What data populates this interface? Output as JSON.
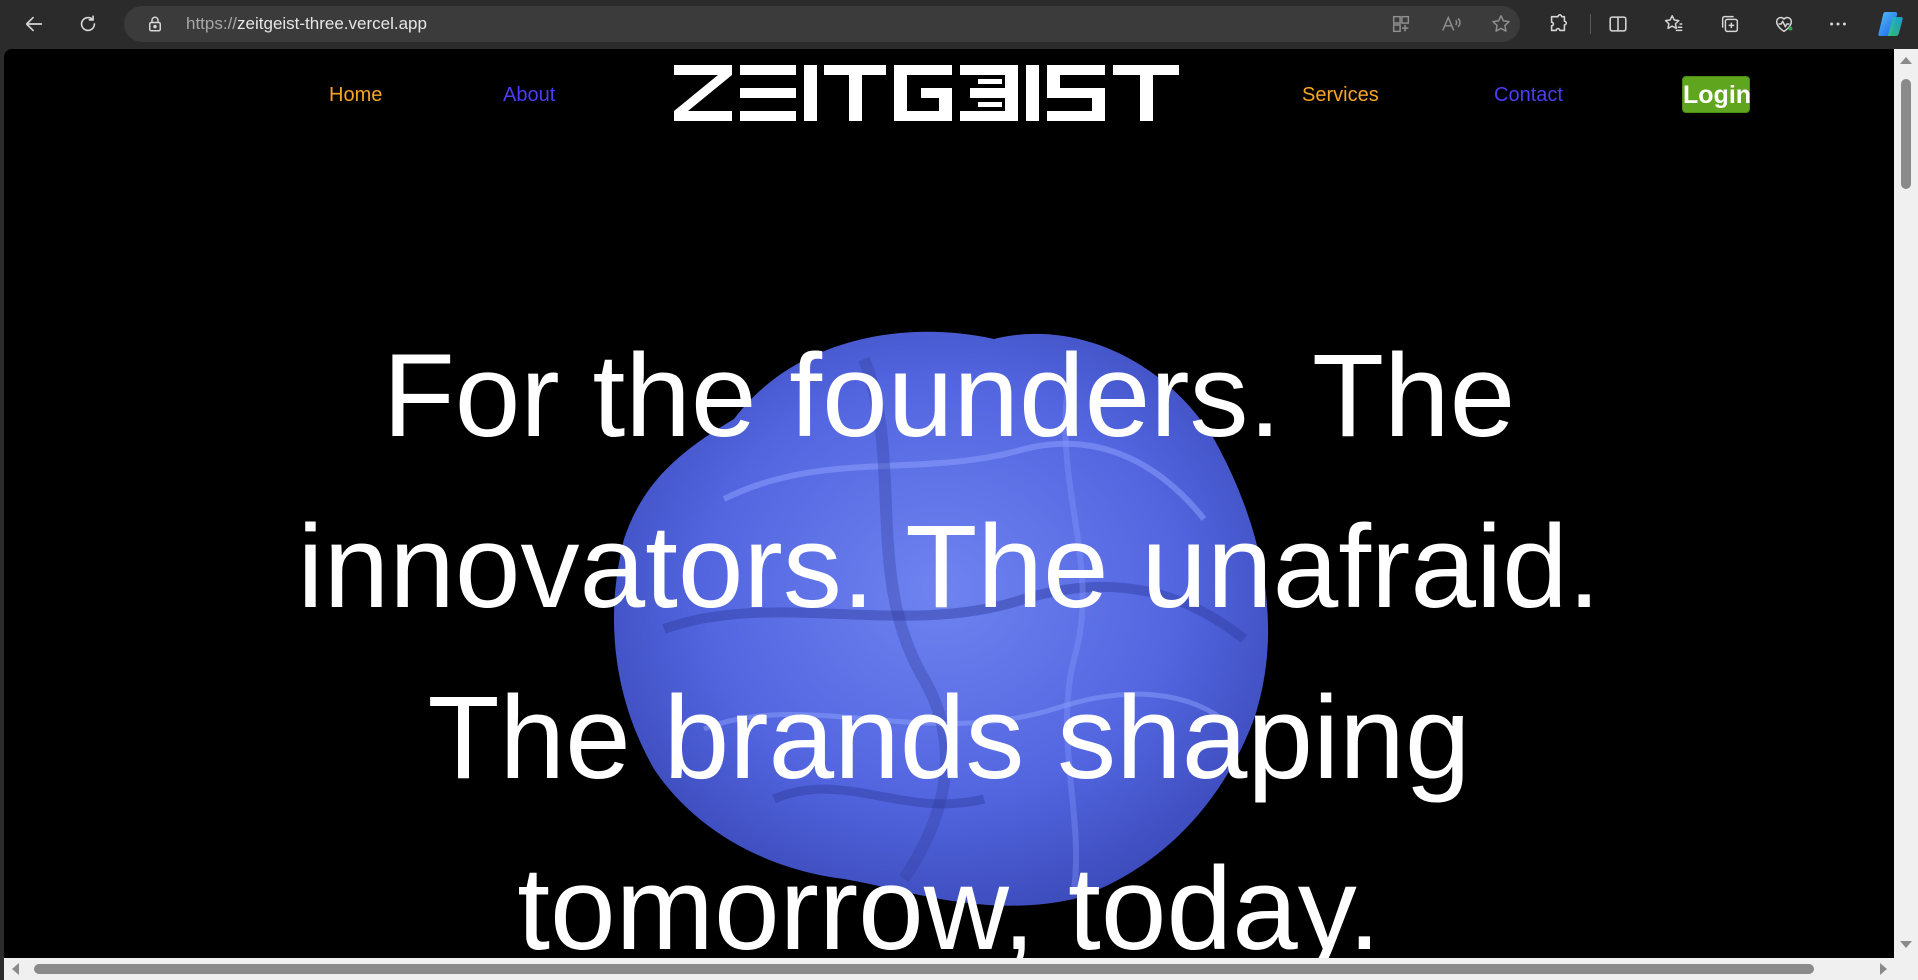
{
  "browser": {
    "url_protocol": "https://",
    "url_host": "zeitgeist-three.vercel.app",
    "icons": [
      "back-icon",
      "refresh-icon",
      "lock-icon",
      "app-available-icon",
      "read-aloud-icon",
      "favorite-star-icon",
      "extensions-icon",
      "split-screen-icon",
      "favorites-icon",
      "collections-icon",
      "browser-essentials-icon",
      "more-icon",
      "copilot-icon"
    ]
  },
  "site": {
    "logo_text": "ZEITGEIST",
    "nav": {
      "home": "Home",
      "about": "About",
      "services": "Services",
      "contact": "Contact",
      "login": "Login"
    },
    "hero_lines": [
      "For the founders. The",
      "innovators. The unafraid.",
      "The brands shaping",
      "tomorrow, today."
    ]
  },
  "colors": {
    "page_background": "#000000",
    "home_link": "#f5a623",
    "about_link": "#4b3df5",
    "services_link": "#f5a623",
    "contact_link": "#4b3df5",
    "login_background": "#5fa51d",
    "hero_text": "#ffffff",
    "blob": "#5a6de8"
  }
}
